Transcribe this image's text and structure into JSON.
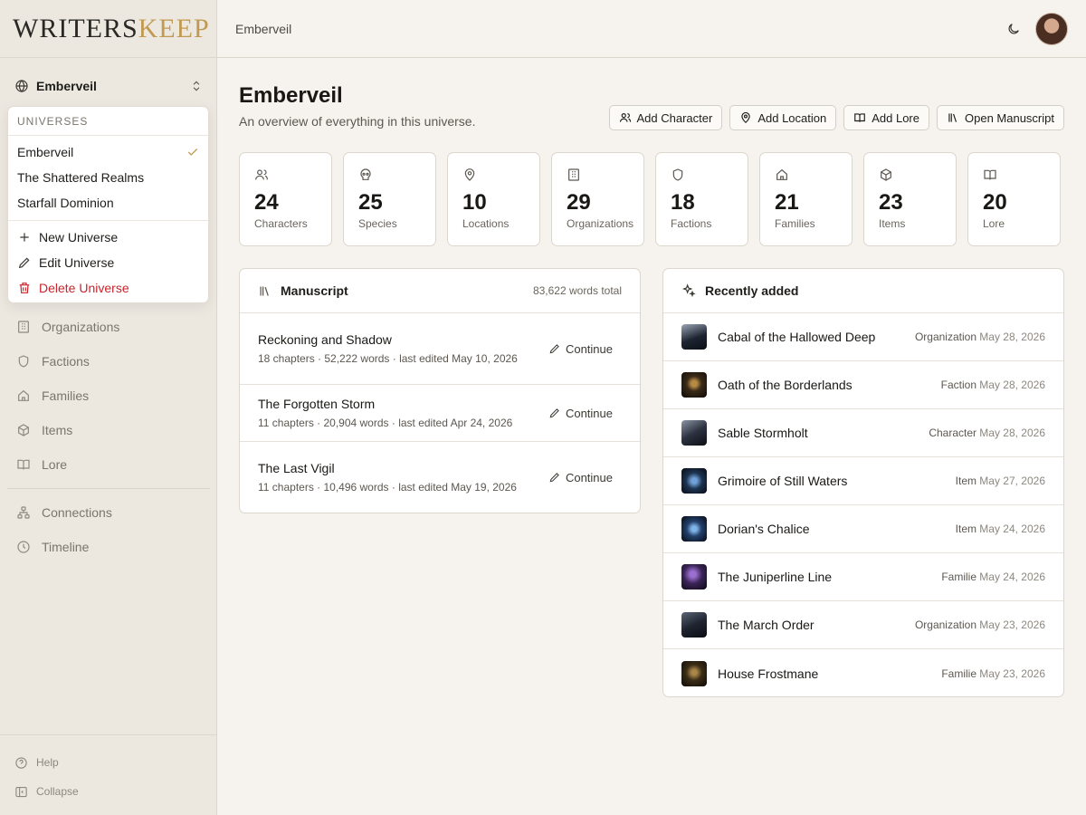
{
  "app": {
    "logo_part1": "WRITERS",
    "logo_part2": "KEEP"
  },
  "universe_switcher": {
    "current": "Emberveil"
  },
  "dropdown": {
    "header": "UNIVERSES",
    "universes": [
      {
        "name": "Emberveil",
        "selected": true
      },
      {
        "name": "The Shattered Realms",
        "selected": false
      },
      {
        "name": "Starfall Dominion",
        "selected": false
      }
    ],
    "actions": {
      "new": "New Universe",
      "edit": "Edit Universe",
      "delete": "Delete Universe"
    }
  },
  "sidebar": {
    "nav": [
      {
        "label": "Organizations",
        "icon": "building-icon"
      },
      {
        "label": "Factions",
        "icon": "shield-icon"
      },
      {
        "label": "Families",
        "icon": "house-icon"
      },
      {
        "label": "Items",
        "icon": "box-icon"
      },
      {
        "label": "Lore",
        "icon": "book-icon"
      }
    ],
    "nav2": [
      {
        "label": "Connections",
        "icon": "network-icon"
      },
      {
        "label": "Timeline",
        "icon": "clock-icon"
      }
    ],
    "help": "Help",
    "collapse": "Collapse"
  },
  "topbar": {
    "breadcrumb": "Emberveil"
  },
  "page": {
    "title": "Emberveil",
    "subtitle": "An overview of everything in this universe.",
    "actions": {
      "add_character": "Add Character",
      "add_location": "Add Location",
      "add_lore": "Add Lore",
      "open_manuscript": "Open Manuscript"
    }
  },
  "stats": [
    {
      "value": "24",
      "label": "Characters"
    },
    {
      "value": "25",
      "label": "Species"
    },
    {
      "value": "10",
      "label": "Locations"
    },
    {
      "value": "29",
      "label": "Organizations"
    },
    {
      "value": "18",
      "label": "Factions"
    },
    {
      "value": "21",
      "label": "Families"
    },
    {
      "value": "23",
      "label": "Items"
    },
    {
      "value": "20",
      "label": "Lore"
    }
  ],
  "manuscript": {
    "title": "Manuscript",
    "total": "83,622 words total",
    "continue_label": "Continue",
    "books": [
      {
        "title": "Reckoning and Shadow",
        "details": "18 chapters · 52,222 words · last edited May 10, 2026"
      },
      {
        "title": "The Forgotten Storm",
        "details": "11 chapters · 20,904 words · last edited Apr 24, 2026"
      },
      {
        "title": "The Last Vigil",
        "details": "11 chapters · 10,496 words · last edited May 19, 2026"
      }
    ]
  },
  "recent": {
    "title": "Recently added",
    "items": [
      {
        "name": "Cabal of the Hallowed Deep",
        "type": "Organization",
        "date": "May 28, 2026"
      },
      {
        "name": "Oath of the Borderlands",
        "type": "Faction",
        "date": "May 28, 2026"
      },
      {
        "name": "Sable Stormholt",
        "type": "Character",
        "date": "May 28, 2026"
      },
      {
        "name": "Grimoire of Still Waters",
        "type": "Item",
        "date": "May 27, 2026"
      },
      {
        "name": "Dorian's Chalice",
        "type": "Item",
        "date": "May 24, 2026"
      },
      {
        "name": "The Juniperline Line",
        "type": "Familie",
        "date": "May 24, 2026"
      },
      {
        "name": "The March Order",
        "type": "Organization",
        "date": "May 23, 2026"
      },
      {
        "name": "House Frostmane",
        "type": "Familie",
        "date": "May 23, 2026"
      }
    ]
  },
  "colors": {
    "accent": "#c19a52",
    "danger": "#c8242b",
    "background": "#f6f3ee",
    "sidebar": "#ece8e0"
  }
}
